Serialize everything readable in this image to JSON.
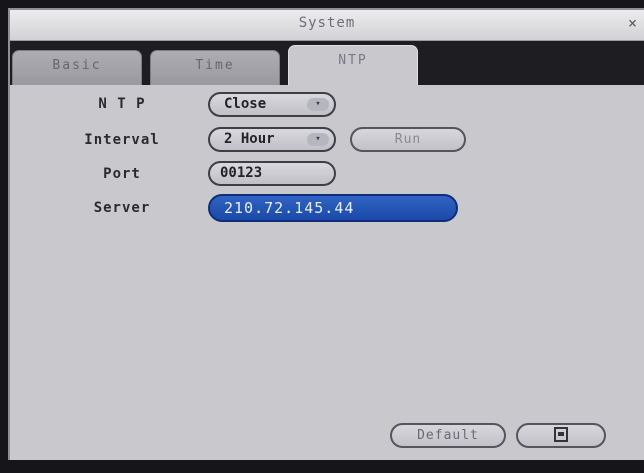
{
  "window": {
    "title": "System",
    "close_symbol": "×"
  },
  "tabs": [
    {
      "label": "Basic",
      "active": false
    },
    {
      "label": "Time",
      "active": false
    },
    {
      "label": "NTP",
      "active": true
    }
  ],
  "form": {
    "ntp": {
      "label": "N T P",
      "value": "Close",
      "arrow_symbol": "▾"
    },
    "interval": {
      "label": "Interval",
      "value": "2 Hour",
      "arrow_symbol": "▾",
      "run_label": "Run"
    },
    "port": {
      "label": "Port",
      "value": "00123"
    },
    "server": {
      "label": "Server",
      "value": "210.72.145.44"
    }
  },
  "footer": {
    "default_label": "Default",
    "save_icon": "save-icon"
  },
  "colors": {
    "window_bg": "#c9c9cd",
    "tab_strip_bg": "#1d1d22",
    "server_field_bg": "#1b4aa8",
    "server_field_text": "#e8eeff"
  }
}
